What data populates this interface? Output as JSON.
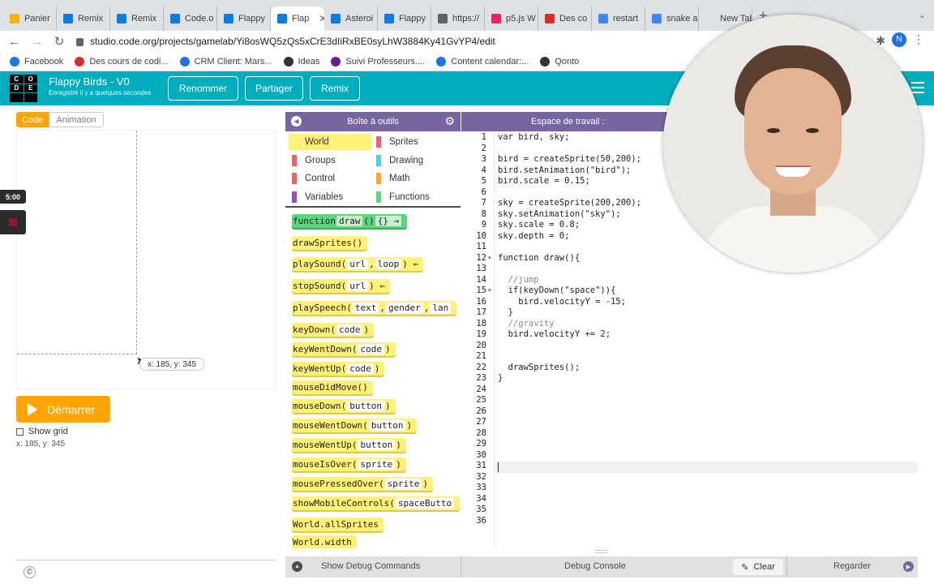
{
  "browser": {
    "tabs": [
      {
        "label": "Panier",
        "color": "#f4b400",
        "w": 66
      },
      {
        "label": "Remix",
        "color": "#0a7be0",
        "w": 66
      },
      {
        "label": "Remix",
        "color": "#0a7be0",
        "w": 66
      },
      {
        "label": "Code.o",
        "color": "#0a7be0",
        "w": 66
      },
      {
        "label": "Flappy",
        "color": "#0a7be0",
        "w": 66
      },
      {
        "label": "Flap",
        "color": "#0a7be0",
        "w": 66,
        "active": true
      },
      {
        "label": "Asteroi",
        "color": "#0a7be0",
        "w": 66
      },
      {
        "label": "Flappy",
        "color": "#0a7be0",
        "w": 66
      },
      {
        "label": "https://",
        "color": "#5f6368",
        "w": 66
      },
      {
        "label": "p5.js W",
        "color": "#ed225d",
        "w": 66
      },
      {
        "label": "Des co",
        "color": "#d93025",
        "w": 66
      },
      {
        "label": "restart",
        "color": "#4285f4",
        "w": 66
      },
      {
        "label": "snake a",
        "color": "#4285f4",
        "w": 66
      },
      {
        "label": "New Tab",
        "color": "#dee1e6",
        "w": 66
      }
    ],
    "url": "studio.code.org/projects/gamelab/Yi8osWQ5zQs5xCrE3dIiRxBE0syLhW3884Ky41GvYP4/edit",
    "profile_initial": "N",
    "bookmarks": [
      {
        "label": "Facebook",
        "color": "#1877f2"
      },
      {
        "label": "Des cours de codi...",
        "color": "#d93025"
      },
      {
        "label": "CRM Client: Mars...",
        "color": "#1a73e8"
      },
      {
        "label": "Ideas",
        "color": "#333333"
      },
      {
        "label": "Suivi Professeurs....",
        "color": "#6a1b9a"
      },
      {
        "label": "Content calendar:...",
        "color": "#1a73e8"
      },
      {
        "label": "Qonto",
        "color": "#333333"
      }
    ]
  },
  "header": {
    "title": "Flappy Birds - V0",
    "subtitle": "Enregistré il y a quelques secondes",
    "logo_letters": [
      "C",
      "O",
      "D",
      "E",
      "",
      ""
    ],
    "buttons": {
      "rename": "Renommer",
      "share": "Partager",
      "remix": "Remix"
    }
  },
  "left": {
    "mode_code": "Code",
    "mode_animation": "Animation",
    "timer": "5:00",
    "tooltip": "x: 185, y: 345",
    "run_label": "Démarrer",
    "show_grid_label": "Show grid",
    "coords": "x: 185,  y: 345",
    "copyright": "©"
  },
  "toolbox": {
    "title": "Boîte à outils",
    "categories": [
      {
        "label": "World",
        "color": "#fff176",
        "active": true
      },
      {
        "label": "Sprites",
        "color": "#f0606d"
      },
      {
        "label": "Groups",
        "color": "#f0606d"
      },
      {
        "label": "Drawing",
        "color": "#4dd0e1"
      },
      {
        "label": "Control",
        "color": "#f0606d"
      },
      {
        "label": "Math",
        "color": "#ffa726"
      },
      {
        "label": "Variables",
        "color": "#9c4dc6"
      },
      {
        "label": "Functions",
        "color": "#5cd67a"
      }
    ],
    "blocks": [
      {
        "parts": [
          "function ",
          "draw",
          "() ",
          "{} →"
        ],
        "fn": true
      },
      {
        "parts": [
          "drawSprites()"
        ]
      },
      {
        "parts": [
          "playSound(",
          "url",
          ", ",
          "loop",
          ") ←"
        ]
      },
      {
        "parts": [
          "stopSound(",
          "url",
          ") ←"
        ]
      },
      {
        "parts": [
          "playSpeech(",
          "text",
          ", ",
          "gender",
          ", ",
          "lan"
        ]
      },
      {
        "parts": [
          "keyDown(",
          "code",
          ")"
        ]
      },
      {
        "parts": [
          "keyWentDown(",
          "code",
          ")"
        ]
      },
      {
        "parts": [
          "keyWentUp(",
          "code",
          ")"
        ]
      },
      {
        "parts": [
          "mouseDidMove()"
        ]
      },
      {
        "parts": [
          "mouseDown(",
          "button",
          ")"
        ]
      },
      {
        "parts": [
          "mouseWentDown(",
          "button",
          ")"
        ]
      },
      {
        "parts": [
          "mouseWentUp(",
          "button",
          ")"
        ]
      },
      {
        "parts": [
          "mouseIsOver(",
          "sprite",
          ")"
        ]
      },
      {
        "parts": [
          "mousePressedOver(",
          "sprite",
          ")"
        ]
      },
      {
        "parts": [
          "showMobileControls(",
          "spaceButto"
        ]
      },
      {
        "parts": [
          "World.allSprites"
        ]
      },
      {
        "parts": [
          "World.width"
        ]
      }
    ]
  },
  "workspace": {
    "title": "Espace de travail :",
    "lines": [
      "var bird, sky;",
      "",
      "bird = createSprite(50,200);",
      "bird.setAnimation(\"bird\");",
      "bird.scale = 0.15;",
      "",
      "sky = createSprite(200,200);",
      "sky.setAnimation(\"sky\");",
      "sky.scale = 0.8;",
      "sky.depth = 0;",
      "",
      "function draw(){",
      "",
      "  //jump",
      "  if(keyDown(\"space\")){",
      "    bird.velocityY = -15;",
      "  }",
      "  //gravity",
      "  bird.velocityY += 2;",
      "",
      "",
      "  drawSprites();",
      "}",
      "",
      "",
      "",
      "",
      "",
      "",
      "",
      "",
      "",
      "",
      "",
      "",
      ""
    ]
  },
  "debug": {
    "commands": "Show Debug Commands",
    "console": "Debug Console",
    "clear": "Clear",
    "watch": "Regarder"
  }
}
